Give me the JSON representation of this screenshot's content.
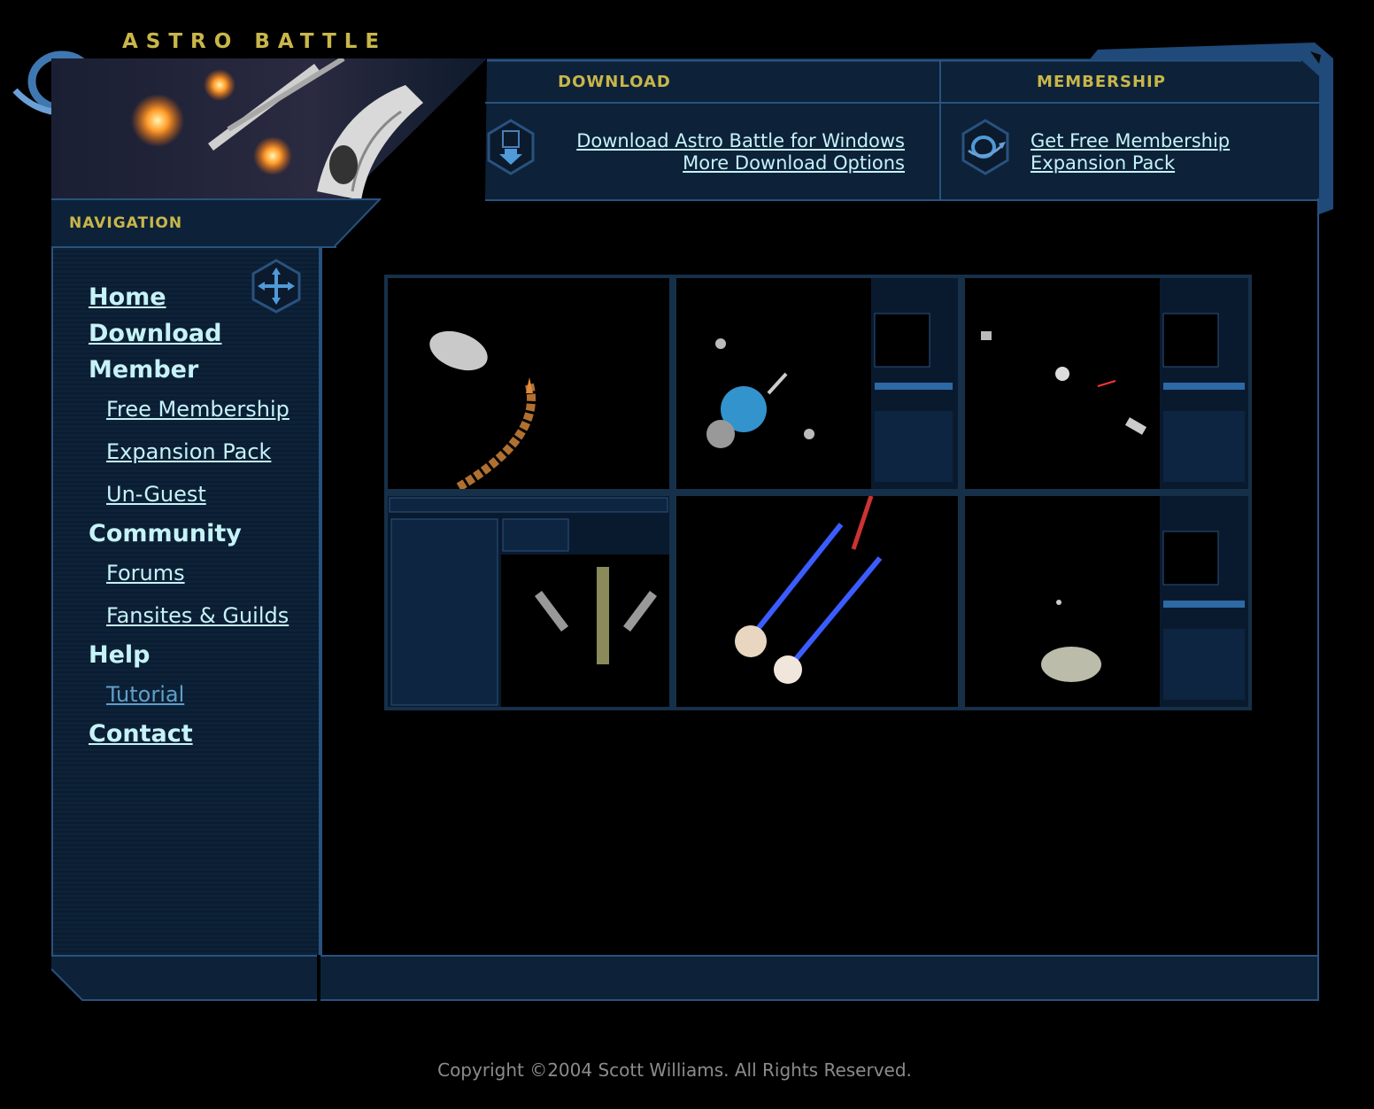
{
  "logo": {
    "text": "ASTRO BATTLE"
  },
  "download": {
    "heading": "DOWNLOAD",
    "links": [
      "Download Astro Battle for Windows",
      "More Download Options"
    ]
  },
  "membership": {
    "heading": "MEMBERSHIP",
    "links": [
      "Get Free Membership",
      "Expansion Pack"
    ]
  },
  "navigation": {
    "heading": "NAVIGATION",
    "items": [
      {
        "label": "Home",
        "type": "main-link"
      },
      {
        "label": "Download",
        "type": "main-link"
      },
      {
        "label": "Member",
        "type": "section"
      },
      {
        "label": "Free Membership",
        "type": "sub"
      },
      {
        "label": "Expansion Pack",
        "type": "sub"
      },
      {
        "label": "Un-Guest",
        "type": "sub"
      },
      {
        "label": "Community",
        "type": "section"
      },
      {
        "label": "Forums",
        "type": "sub"
      },
      {
        "label": "Fansites & Guilds",
        "type": "sub"
      },
      {
        "label": "Help",
        "type": "section"
      },
      {
        "label": "Tutorial",
        "type": "sub-visited"
      },
      {
        "label": "Contact",
        "type": "main-link"
      }
    ]
  },
  "screenshots": {
    "count": 6,
    "items": [
      "asteroid-gameplay",
      "radar-gameplay",
      "combat-gameplay",
      "ship-editor",
      "beam-weapons",
      "asteroid-radar"
    ]
  },
  "footer": {
    "copyright": "Copyright ©2004 Scott Williams. All Rights Reserved."
  },
  "colors": {
    "background": "#000000",
    "frame": "#29527f",
    "panel": "#0d2238",
    "gold": "#c9b64a",
    "link": "#c6f2f8",
    "visited": "#5f9fc9",
    "copyright": "#8b8b8b"
  }
}
